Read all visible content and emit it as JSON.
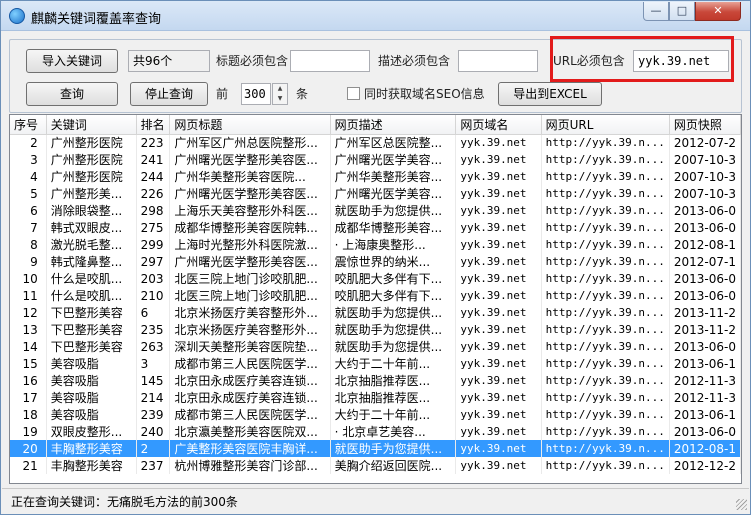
{
  "window": {
    "title": "麒麟关键词覆盖率查询",
    "min_label": "—",
    "max_label": "□",
    "close_label": "✕"
  },
  "toolbar": {
    "import_button": "导入关键词",
    "count_value": "共96个",
    "title_contains_label": "标题必须包含",
    "title_contains_value": "",
    "desc_contains_label": "描述必须包含",
    "desc_contains_value": "",
    "url_contains_label": "URL必须包含",
    "url_contains_value": "yyk.39.net",
    "query_button": "查询",
    "stop_button": "停止查询",
    "top_label": "前",
    "top_value": "300",
    "unit_label": "条",
    "seo_checkbox_label": "同时获取域名SEO信息",
    "seo_checked": false,
    "export_button": "导出到EXCEL",
    "accent_highlight": "#e21b1b"
  },
  "table": {
    "headers": [
      "序号",
      "关键词",
      "排名",
      "网页标题",
      "网页描述",
      "网页域名",
      "网页URL",
      "网页快照"
    ],
    "rows": [
      [
        "2",
        "广州整形医院",
        "223",
        "广州军区广州总医院整形...",
        "广州军区总医院整...",
        "yyk.39.net",
        "http://yyk.39.n...",
        "2012-07-2"
      ],
      [
        "3",
        "广州整形医院",
        "241",
        "广州曙光医学整形美容医...",
        "广州曙光医学美容...",
        "yyk.39.net",
        "http://yyk.39.n...",
        "2007-10-3"
      ],
      [
        "4",
        "广州整形医院",
        "244",
        "广州华美整形美容医院...",
        "广州华美整形美容...",
        "yyk.39.net",
        "http://yyk.39.n...",
        "2007-10-3"
      ],
      [
        "5",
        "广州整形美...",
        "226",
        "广州曙光医学整形美容医...",
        "广州曙光医学美容...",
        "yyk.39.net",
        "http://yyk.39.n...",
        "2007-10-3"
      ],
      [
        "6",
        "消除眼袋整...",
        "298",
        "上海乐天美容整形外科医...",
        "就医助手为您提供...",
        "yyk.39.net",
        "http://yyk.39.n...",
        "2013-06-0"
      ],
      [
        "7",
        "韩式双眼皮...",
        "275",
        "成都华博整形美容医院韩...",
        "成都华博整形美容...",
        "yyk.39.net",
        "http://yyk.39.n...",
        "2013-06-0"
      ],
      [
        "8",
        "激光脱毛整...",
        "299",
        "上海时光整形外科医院激...",
        "· 上海康奥整形...",
        "yyk.39.net",
        "http://yyk.39.n...",
        "2012-08-1"
      ],
      [
        "9",
        "韩式隆鼻整...",
        "297",
        "广州曙光医学整形美容医...",
        "震惊世界的纳米...",
        "yyk.39.net",
        "http://yyk.39.n...",
        "2012-07-1"
      ],
      [
        "10",
        "什么是咬肌...",
        "203",
        "北医三院上地门诊咬肌肥...",
        "咬肌肥大多伴有下...",
        "yyk.39.net",
        "http://yyk.39.n...",
        "2013-06-0"
      ],
      [
        "11",
        "什么是咬肌...",
        "210",
        "北医三院上地门诊咬肌肥...",
        "咬肌肥大多伴有下...",
        "yyk.39.net",
        "http://yyk.39.n...",
        "2013-06-0"
      ],
      [
        "12",
        "下巴整形美容",
        "6",
        "北京米扬医疗美容整形外...",
        "就医助手为您提供...",
        "yyk.39.net",
        "http://yyk.39.n...",
        "2013-11-2"
      ],
      [
        "13",
        "下巴整形美容",
        "235",
        "北京米扬医疗美容整形外...",
        "就医助手为您提供...",
        "yyk.39.net",
        "http://yyk.39.n...",
        "2013-11-2"
      ],
      [
        "14",
        "下巴整形美容",
        "263",
        "深圳天美整形美容医院垫...",
        "就医助手为您提供...",
        "yyk.39.net",
        "http://yyk.39.n...",
        "2013-06-0"
      ],
      [
        "15",
        "美容吸脂",
        "3",
        "成都市第三人民医院医学...",
        "大约于二十年前...",
        "yyk.39.net",
        "http://yyk.39.n...",
        "2013-06-1"
      ],
      [
        "16",
        "美容吸脂",
        "145",
        "北京田永成医疗美容连锁...",
        "北京抽脂推荐医...",
        "yyk.39.net",
        "http://yyk.39.n...",
        "2012-11-3"
      ],
      [
        "17",
        "美容吸脂",
        "214",
        "北京田永成医疗美容连锁...",
        "北京抽脂推荐医...",
        "yyk.39.net",
        "http://yyk.39.n...",
        "2012-11-3"
      ],
      [
        "18",
        "美容吸脂",
        "239",
        "成都市第三人民医院医学...",
        "大约于二十年前...",
        "yyk.39.net",
        "http://yyk.39.n...",
        "2013-06-1"
      ],
      [
        "19",
        "双眼皮整形...",
        "240",
        "北京瀛美整形美容医院双...",
        "· 北京卓艺美容...",
        "yyk.39.net",
        "http://yyk.39.n...",
        "2013-06-0"
      ],
      [
        "20",
        "丰胸整形美容",
        "2",
        "广美整形美容医院丰胸详...",
        "就医助手为您提供...",
        "yyk.39.net",
        "http://yyk.39.n...",
        "2012-08-1"
      ],
      [
        "21",
        "丰胸整形美容",
        "237",
        "杭州博雅整形美容门诊部...",
        "美胸介绍返回医院...",
        "yyk.39.net",
        "http://yyk.39.n...",
        "2012-12-2"
      ]
    ],
    "selected_row_index": 18,
    "selection_color": "#3399ff"
  },
  "status": {
    "text": "正在查询关键词：无痛脱毛方法的前300条"
  }
}
